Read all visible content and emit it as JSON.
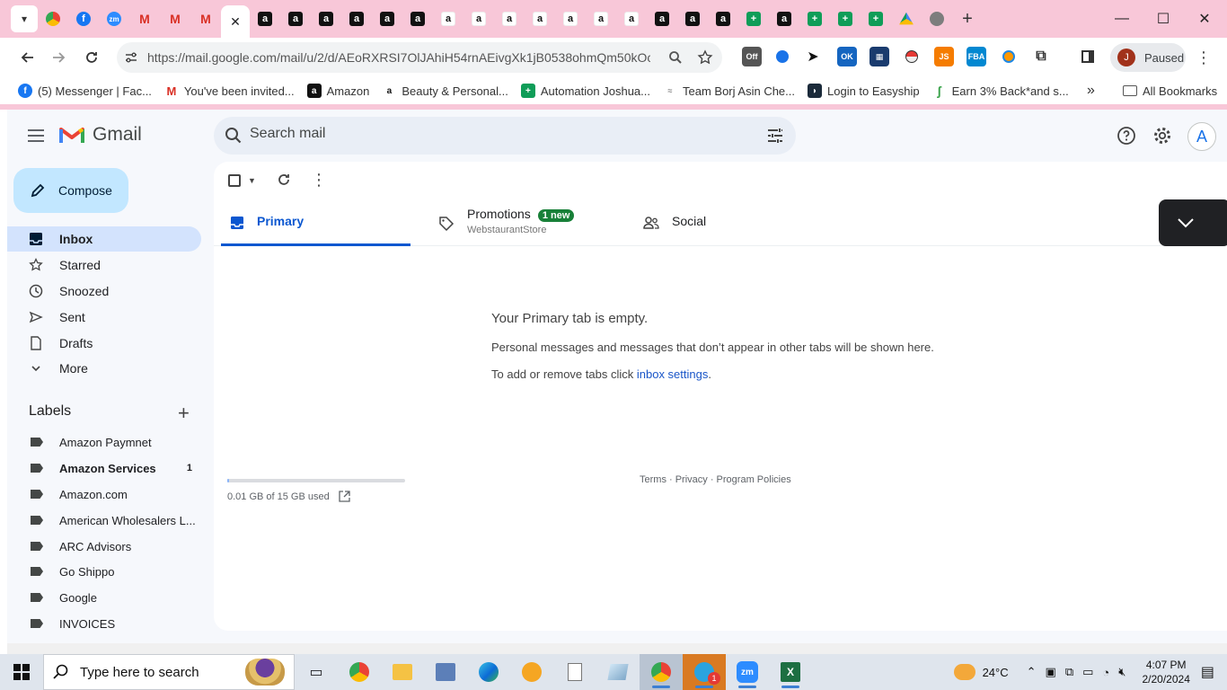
{
  "browser": {
    "active_tab_close": "✕",
    "new_tab": "+",
    "url": "https://mail.google.com/mail/u/2/d/AEoRXRSI7OlJAhiH54rnAEivgXk1jB0538ohmQm50kOc...",
    "profile_initial": "J",
    "profile_status": "Paused",
    "ext_off": "Off",
    "ext_ok": "OK",
    "ext_js": "JS",
    "ext_fba": "FBA"
  },
  "bookmarks": [
    {
      "label": "(5) Messenger | Fac...",
      "icon": "facebook-icon",
      "color": "#1877f2"
    },
    {
      "label": "You've been invited...",
      "icon": "gmail-icon",
      "color": "#d93025"
    },
    {
      "label": "Amazon",
      "icon": "amazon-icon",
      "color": "#111111"
    },
    {
      "label": "Beauty & Personal...",
      "icon": "amazon-icon",
      "color": "#111111"
    },
    {
      "label": "Automation Joshua...",
      "icon": "sheets-icon",
      "color": "#0f9d58"
    },
    {
      "label": "Team Borj Asin Che...",
      "icon": "tb-icon",
      "color": "#888888"
    },
    {
      "label": "Login to Easyship",
      "icon": "easyship-icon",
      "color": "#1b2a3a"
    },
    {
      "label": "Earn 3% Back*and s...",
      "icon": "cashback-icon",
      "color": "#3aa34b"
    }
  ],
  "all_bookmarks": "All Bookmarks",
  "gmail": {
    "logo_text": "Gmail",
    "search_placeholder": "Search mail",
    "account_initial": "A",
    "compose": "Compose",
    "nav": [
      {
        "label": "Inbox",
        "icon": "inbox-icon"
      },
      {
        "label": "Starred",
        "icon": "star-icon"
      },
      {
        "label": "Snoozed",
        "icon": "clock-icon"
      },
      {
        "label": "Sent",
        "icon": "send-icon"
      },
      {
        "label": "Drafts",
        "icon": "draft-icon"
      },
      {
        "label": "More",
        "icon": "chevron-down-icon"
      }
    ],
    "labels_header": "Labels",
    "labels": [
      {
        "label": "Amazon Paymnet",
        "count": ""
      },
      {
        "label": "Amazon Services",
        "count": "1"
      },
      {
        "label": "Amazon.com",
        "count": ""
      },
      {
        "label": "American Wholesalers L...",
        "count": ""
      },
      {
        "label": "ARC Advisors",
        "count": ""
      },
      {
        "label": "Go Shippo",
        "count": ""
      },
      {
        "label": "Google",
        "count": ""
      },
      {
        "label": "INVOICES",
        "count": ""
      }
    ],
    "tabs": {
      "primary": "Primary",
      "promotions": "Promotions",
      "promotions_badge": "1 new",
      "promotions_sub": "WebstaurantStore",
      "social": "Social"
    },
    "empty": {
      "title": "Your Primary tab is empty.",
      "desc": "Personal messages and messages that don’t appear in other tabs will be shown here.",
      "settings_prefix": "To add or remove tabs click ",
      "settings_link": "inbox settings",
      "settings_suffix": "."
    },
    "storage": {
      "text": "0.01 GB of 15 GB used",
      "used_fraction": 0.001
    },
    "footer": "Terms · Privacy · Program Policies"
  },
  "taskbar": {
    "search_placeholder": "Type here to search",
    "weather": "24°C",
    "time": "4:07 PM",
    "date": "2/20/2024",
    "telegram_badge": "1",
    "zoom_label": "zm"
  }
}
